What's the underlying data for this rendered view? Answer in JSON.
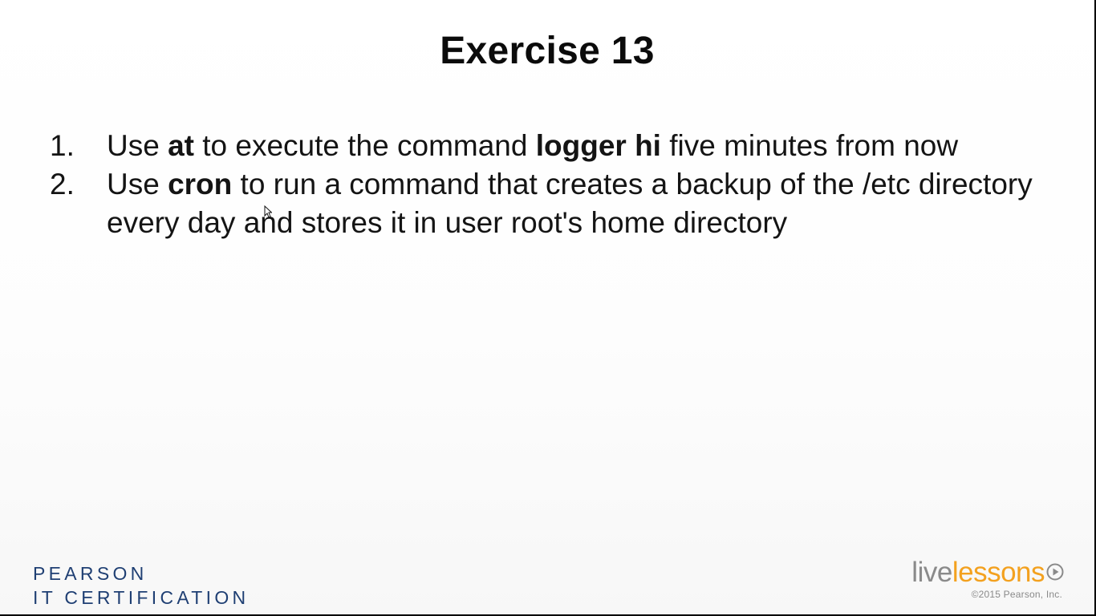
{
  "slide": {
    "title": "Exercise 13",
    "items": [
      {
        "number": "1.",
        "segments": [
          {
            "text": "Use ",
            "bold": false
          },
          {
            "text": "at",
            "bold": true
          },
          {
            "text": " to execute the command ",
            "bold": false
          },
          {
            "text": "logger hi",
            "bold": true
          },
          {
            "text": " five minutes from now",
            "bold": false
          }
        ]
      },
      {
        "number": "2.",
        "segments": [
          {
            "text": "Use ",
            "bold": false
          },
          {
            "text": "cron",
            "bold": true
          },
          {
            "text": " to run a command that creates a backup of the /etc directory every day and stores it in user root's home directory",
            "bold": false
          }
        ]
      }
    ]
  },
  "branding": {
    "pearson_line1": "PEARSON",
    "pearson_line2": "IT CERTIFICATION",
    "livelessons_live": "live",
    "livelessons_lessons": "lessons",
    "copyright": "©2015 Pearson, Inc.",
    "pearson_color": "#1f3f73",
    "live_color": "#8a8a8a",
    "lessons_color": "#f3a11f"
  },
  "icons": {
    "play": "play-circle-icon",
    "cursor": "mouse-pointer-icon"
  }
}
